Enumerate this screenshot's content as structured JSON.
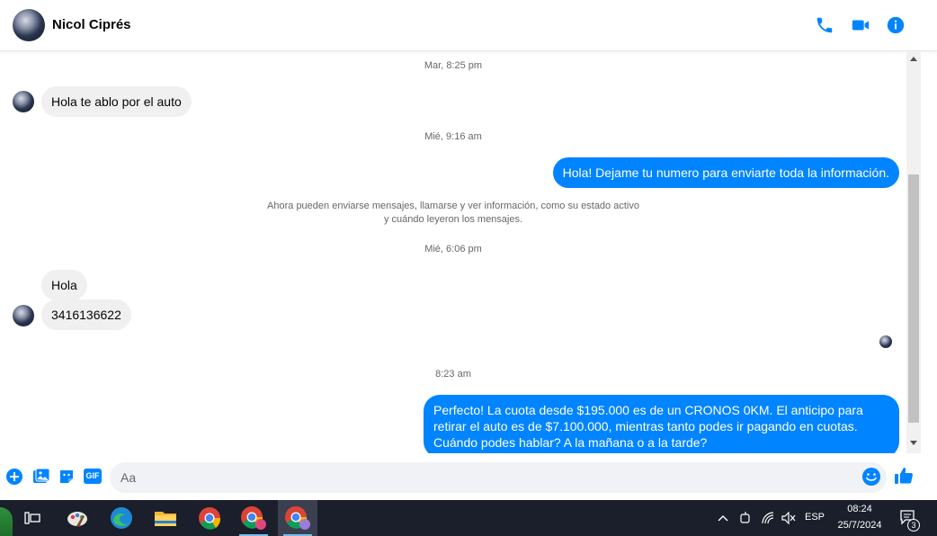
{
  "header": {
    "contact_name": "Nicol Ciprés",
    "icons": [
      "phone-icon",
      "video-icon",
      "info-icon"
    ],
    "accent_color": "#0084ff"
  },
  "conversation": {
    "timestamps": [
      "Mar, 8:25 pm",
      "Mié, 9:16 am",
      "Mié, 6:06 pm",
      "8:23 am"
    ],
    "system_message_line1": "Ahora pueden enviarse mensajes, llamarse y ver información, como su estado activo",
    "system_message_line2": "y cuándo leyeron los mensajes.",
    "messages": [
      {
        "from": "them",
        "text": "Hola te ablo por el auto"
      },
      {
        "from": "me",
        "text": "Hola! Dejame tu numero  para enviarte toda la información."
      },
      {
        "from": "them",
        "text": "Hola"
      },
      {
        "from": "them",
        "text": "3416136622"
      },
      {
        "from": "me",
        "text": "Perfecto! La cuota desde $195.000 es de un CRONOS 0KM. El anticipo para retirar el auto es de $7.100.000, mientras tanto podes ir pagando en cuotas. Cuándo podes hablar? A la mañana o a la tarde?"
      }
    ]
  },
  "composer": {
    "placeholder": "Aa",
    "icons": [
      "add-icon",
      "image-icon",
      "sticker-icon",
      "gif-icon",
      "emoji-icon",
      "like-icon"
    ],
    "gif_label": "GIF"
  },
  "taskbar": {
    "apps": [
      "task-view-icon",
      "paint-icon",
      "edge-icon",
      "file-explorer-icon",
      "chrome-icon",
      "chrome-profile-icon",
      "chrome-active-icon"
    ],
    "language": "ESP",
    "time": "08:24",
    "date": "25/7/2024",
    "notification_count": "3"
  }
}
